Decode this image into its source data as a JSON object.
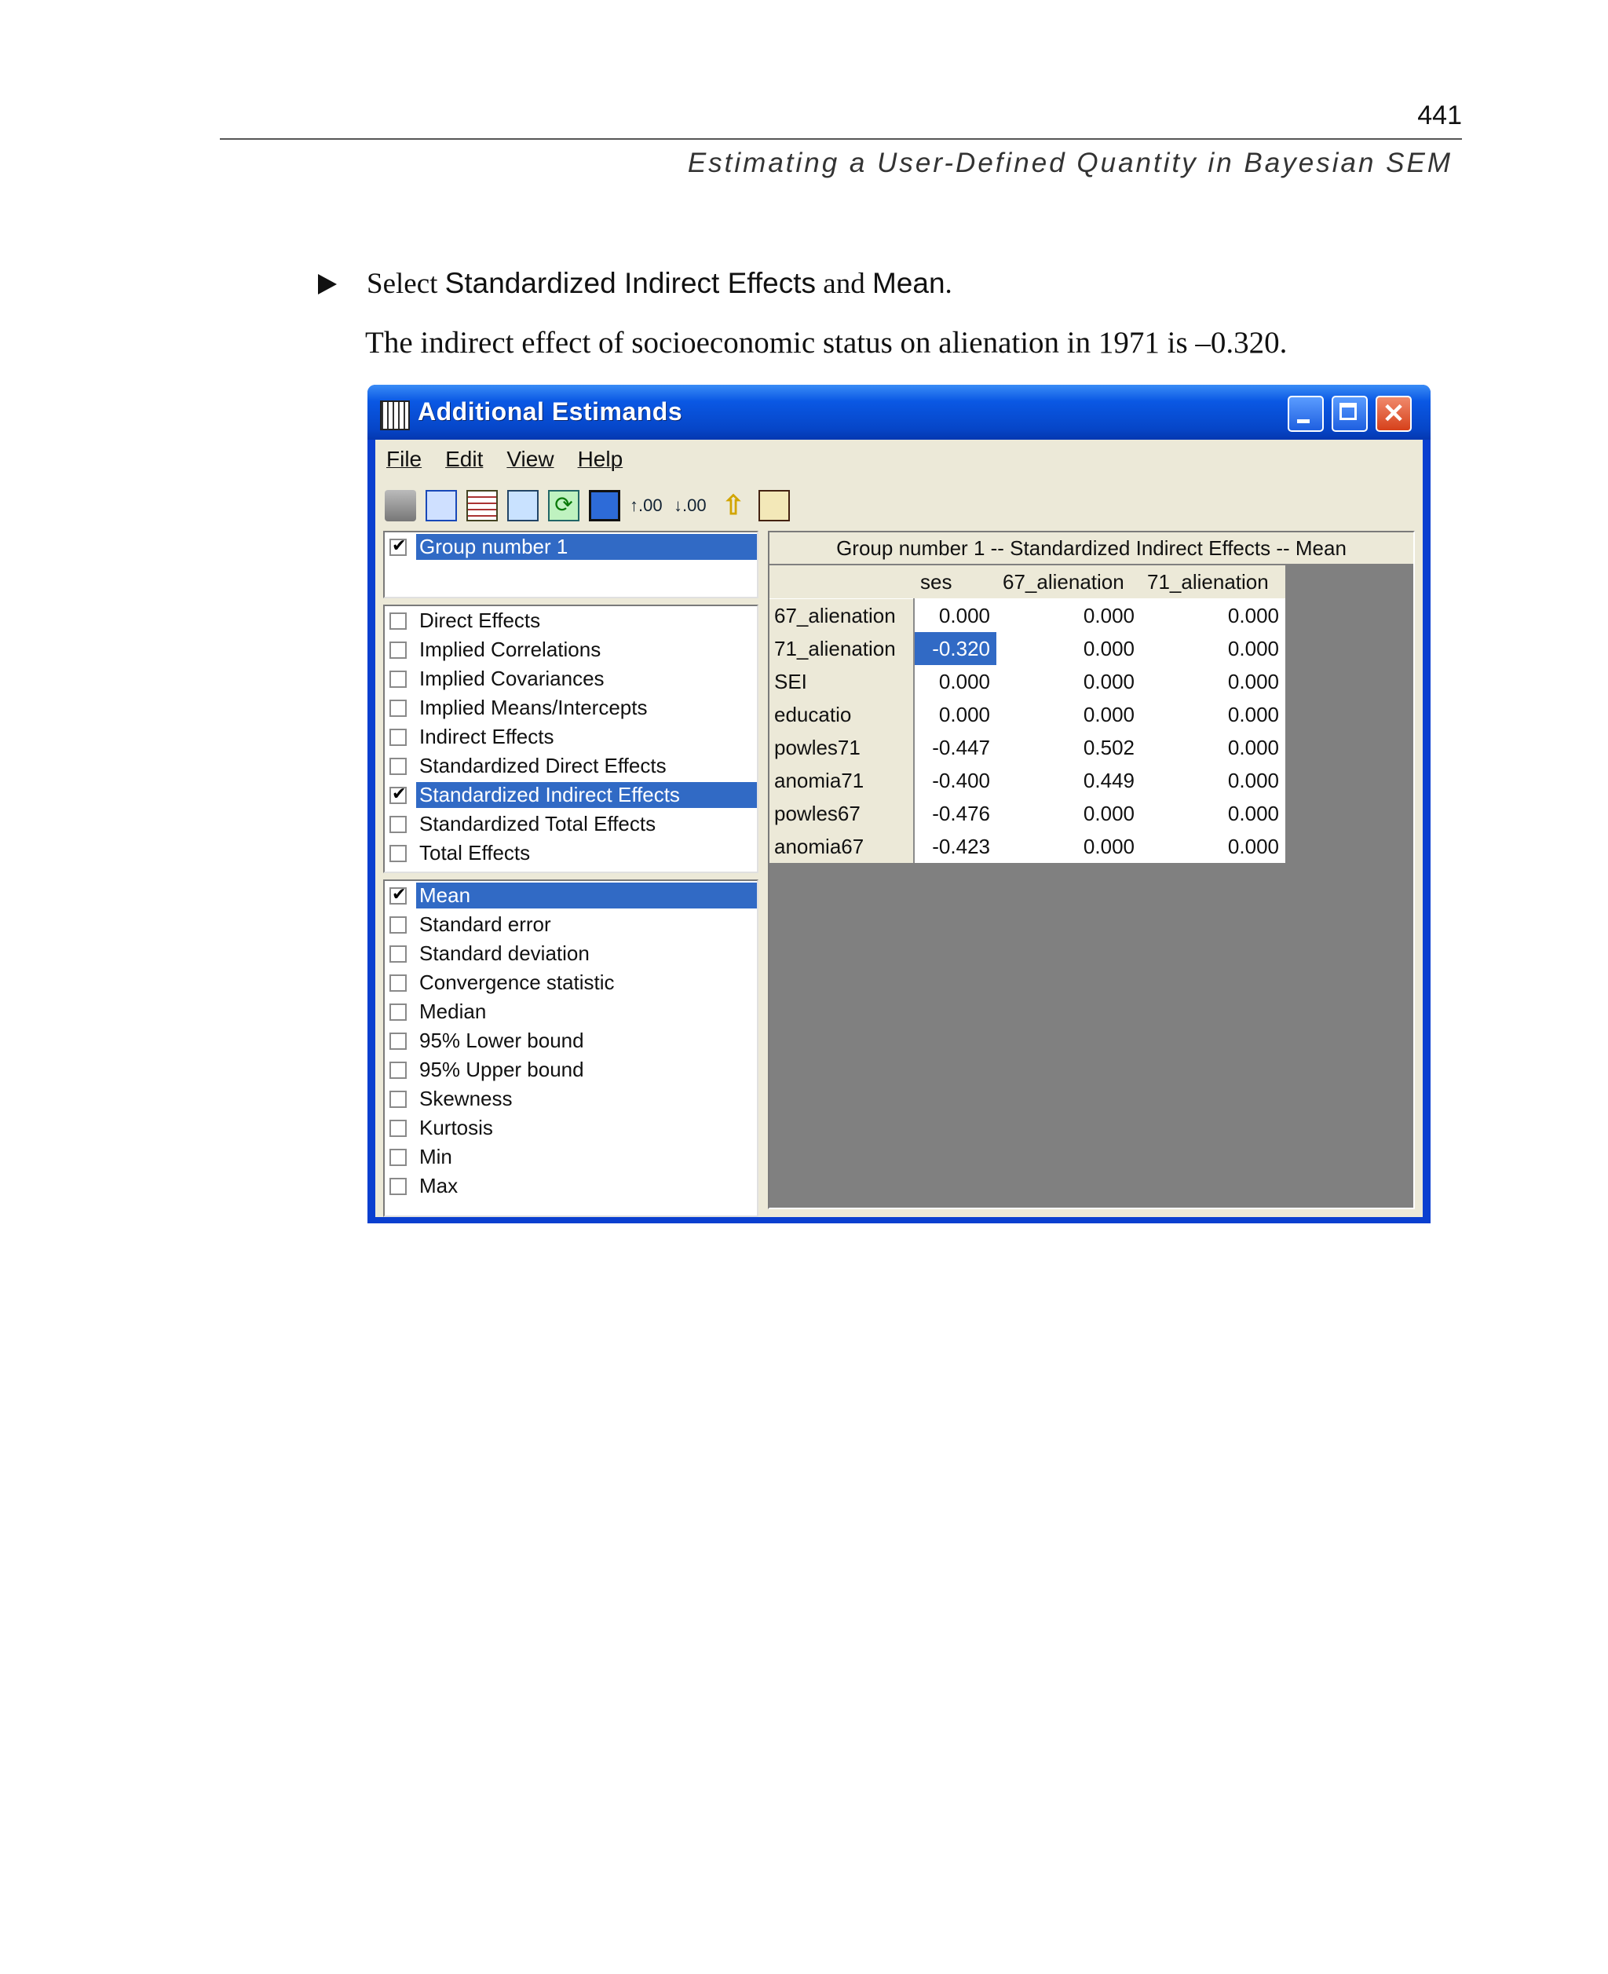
{
  "page": {
    "number": "441",
    "running_head": "Estimating a User-Defined Quantity in Bayesian SEM",
    "instruction_pre": "Select ",
    "instruction_bold": "Standardized Indirect Effects",
    "instruction_mid": " and ",
    "instruction_bold2": "Mean",
    "instruction_post": ".",
    "body_text": "The indirect effect of socioeconomic status on alienation in 1971 is –0.320."
  },
  "window": {
    "title": "Additional Estimands",
    "close_glyph": "✕",
    "menu": [
      "File",
      "Edit",
      "View",
      "Help"
    ],
    "toolbar": [
      "print-icon",
      "print-preview-icon",
      "copy-icon",
      "copy-table-icon",
      "refresh-icon",
      "figure-icon",
      "increase-decimals-icon",
      "decrease-decimals-icon",
      "up-arrow-icon",
      "help-book-icon"
    ],
    "toolbar_labels": {
      "inc": "↑.00",
      "dec": "↓.00",
      "up": "⇧"
    },
    "group_list": [
      {
        "label": "Group number 1",
        "checked": true,
        "selected": true
      }
    ],
    "estimands": [
      {
        "label": "Direct Effects",
        "checked": false
      },
      {
        "label": "Implied Correlations",
        "checked": false
      },
      {
        "label": "Implied Covariances",
        "checked": false
      },
      {
        "label": "Implied Means/Intercepts",
        "checked": false
      },
      {
        "label": "Indirect Effects",
        "checked": false
      },
      {
        "label": "Standardized Direct Effects",
        "checked": false
      },
      {
        "label": "Standardized Indirect Effects",
        "checked": true,
        "selected": true
      },
      {
        "label": "Standardized Total Effects",
        "checked": false
      },
      {
        "label": "Total Effects",
        "checked": false
      }
    ],
    "statistics": [
      {
        "label": "Mean",
        "checked": true,
        "selected": true
      },
      {
        "label": "Standard error",
        "checked": false
      },
      {
        "label": "Standard deviation",
        "checked": false
      },
      {
        "label": "Convergence statistic",
        "checked": false
      },
      {
        "label": "Median",
        "checked": false
      },
      {
        "label": "95% Lower bound",
        "checked": false
      },
      {
        "label": "95% Upper bound",
        "checked": false
      },
      {
        "label": "Skewness",
        "checked": false
      },
      {
        "label": "Kurtosis",
        "checked": false
      },
      {
        "label": "Min",
        "checked": false
      },
      {
        "label": "Max",
        "checked": false
      }
    ],
    "grid": {
      "caption": "Group number 1 -- Standardized Indirect Effects -- Mean",
      "columns": [
        "ses",
        "67_alienation",
        "71_alienation"
      ],
      "rows": [
        {
          "name": "67_alienation",
          "values": [
            "0.000",
            "0.000",
            "0.000"
          ]
        },
        {
          "name": "71_alienation",
          "values": [
            "-0.320",
            "0.000",
            "0.000"
          ],
          "highlight": 0
        },
        {
          "name": "SEI",
          "values": [
            "0.000",
            "0.000",
            "0.000"
          ]
        },
        {
          "name": "educatio",
          "values": [
            "0.000",
            "0.000",
            "0.000"
          ]
        },
        {
          "name": "powles71",
          "values": [
            "-0.447",
            "0.502",
            "0.000"
          ]
        },
        {
          "name": "anomia71",
          "values": [
            "-0.400",
            "0.449",
            "0.000"
          ]
        },
        {
          "name": "powles67",
          "values": [
            "-0.476",
            "0.000",
            "0.000"
          ]
        },
        {
          "name": "anomia67",
          "values": [
            "-0.423",
            "0.000",
            "0.000"
          ]
        }
      ]
    }
  }
}
